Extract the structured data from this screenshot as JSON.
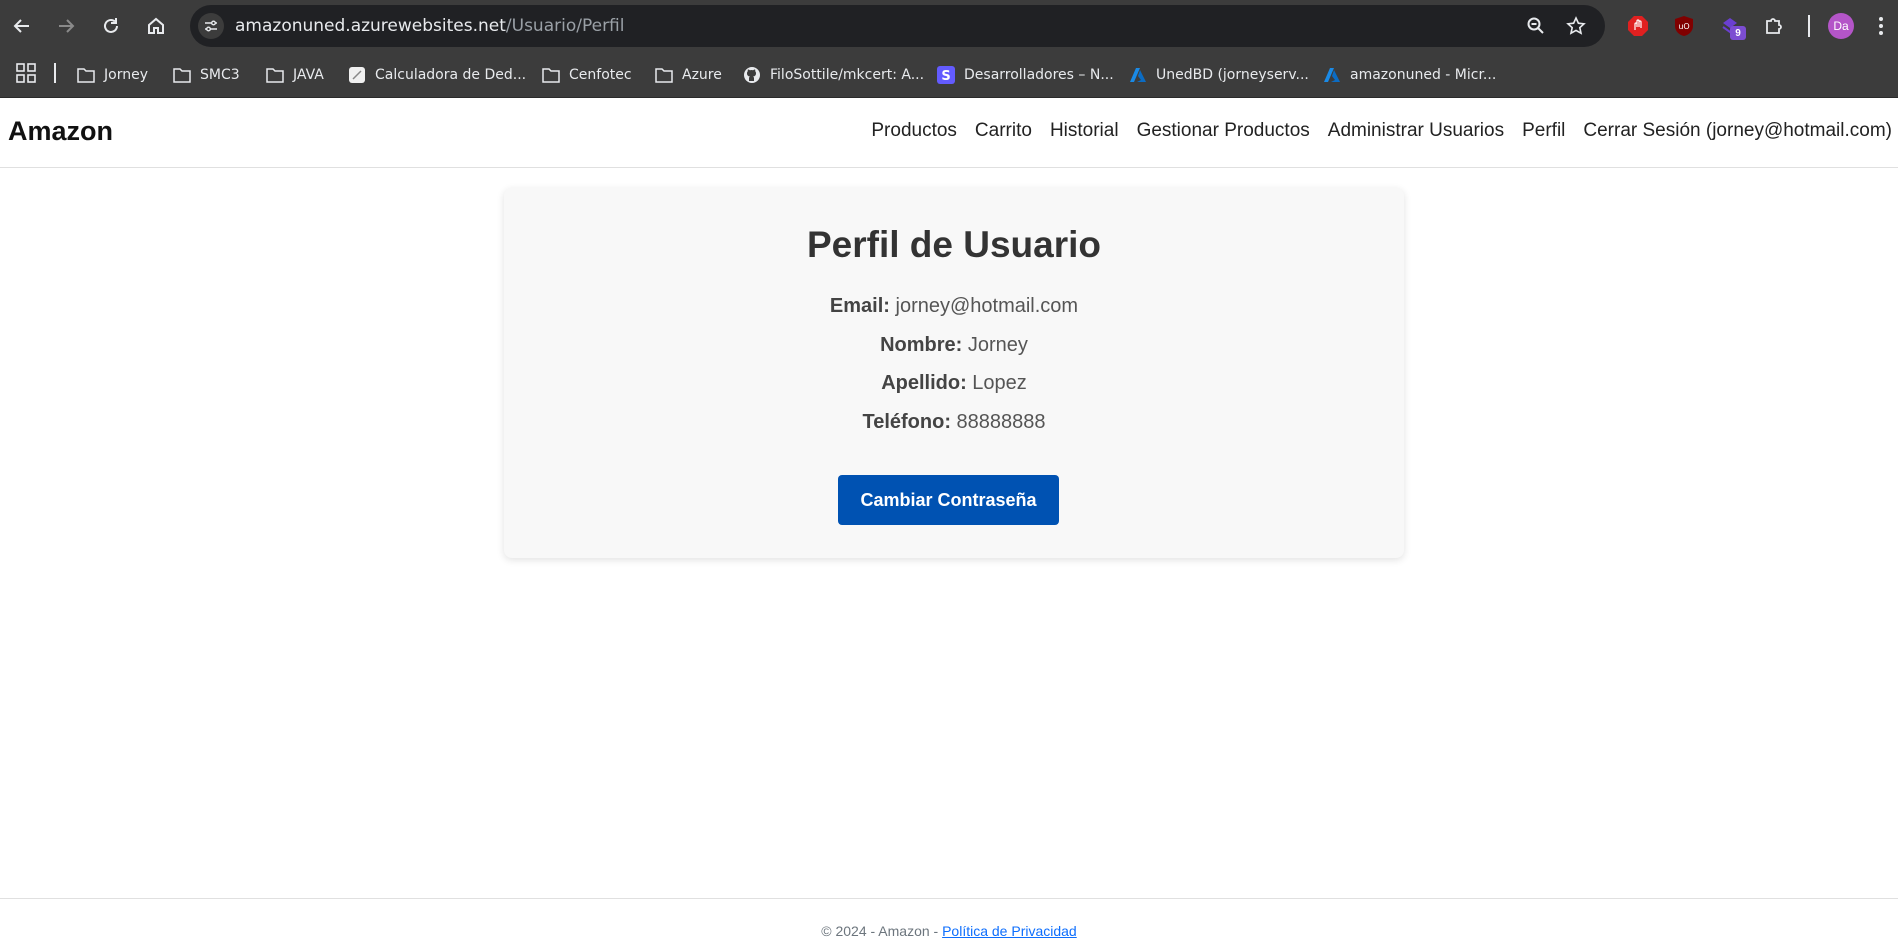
{
  "browser": {
    "url_host": "amazonuned.azurewebsites.net",
    "url_path": "/Usuario/Perfil",
    "extension_badge": "9",
    "profile_initials": "Da",
    "bookmarks": [
      {
        "label": "Jorney",
        "icon": "folder-icon"
      },
      {
        "label": "SMC3",
        "icon": "folder-icon"
      },
      {
        "label": "JAVA",
        "icon": "folder-icon"
      },
      {
        "label": "Calculadora de Ded...",
        "icon": "calculator-favicon"
      },
      {
        "label": "Cenfotec",
        "icon": "folder-icon"
      },
      {
        "label": "Azure",
        "icon": "folder-icon"
      },
      {
        "label": "FiloSottile/mkcert: A...",
        "icon": "github-icon"
      },
      {
        "label": "Desarrolladores – N...",
        "icon": "stripe-icon"
      },
      {
        "label": "UnedBD (jorneyserv...",
        "icon": "azure-icon"
      },
      {
        "label": "amazonuned - Micr...",
        "icon": "azure-icon"
      }
    ]
  },
  "header": {
    "brand": "Amazon",
    "nav": {
      "productos": "Productos",
      "carrito": "Carrito",
      "historial": "Historial",
      "gestionar": "Gestionar Productos",
      "administrar": "Administrar Usuarios",
      "perfil": "Perfil",
      "cerrar": "Cerrar Sesión (jorney@hotmail.com)"
    }
  },
  "profile": {
    "title": "Perfil de Usuario",
    "email_label": "Email:",
    "email": "jorney@hotmail.com",
    "nombre_label": "Nombre:",
    "nombre": "Jorney",
    "apellido_label": "Apellido:",
    "apellido": "Lopez",
    "telefono_label": "Teléfono:",
    "telefono": "88888888",
    "change_password_button": "Cambiar Contraseña"
  },
  "footer": {
    "copyright": "© 2024 - Amazon - ",
    "privacy_link": "Política de Privacidad"
  },
  "colors": {
    "chrome_bg": "#3c3c3c",
    "omnibox_bg": "#202124",
    "button_primary": "#0052b2",
    "link": "#0d6efd"
  }
}
